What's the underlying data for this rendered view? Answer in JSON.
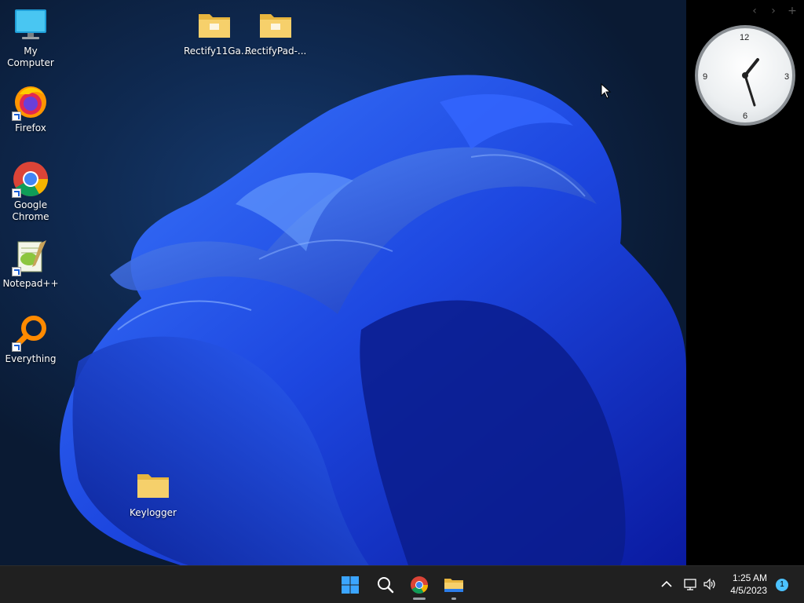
{
  "desktop": {
    "icons": [
      {
        "label": "My Computer",
        "icon": "monitor-icon"
      },
      {
        "label": "Firefox",
        "icon": "firefox-icon"
      },
      {
        "label": "Google Chrome",
        "icon": "chrome-icon"
      },
      {
        "label": "Notepad++",
        "icon": "notepad-plus-plus-icon"
      },
      {
        "label": "Everything",
        "icon": "everything-search-icon"
      },
      {
        "label": "Rectify11Ga...",
        "icon": "folder-icon"
      },
      {
        "label": "RectifyPad-...",
        "icon": "folder-icon"
      },
      {
        "label": "Keylogger",
        "icon": "folder-icon"
      }
    ]
  },
  "sidebar": {
    "nav": {
      "prev": "‹",
      "next": "›",
      "add": "+"
    },
    "clock": {
      "n12": "12",
      "n3": "3",
      "n6": "6",
      "n9": "9"
    }
  },
  "taskbar": {
    "pinned": [
      {
        "name": "start",
        "icon": "windows-start-icon"
      },
      {
        "name": "search",
        "icon": "search-icon"
      },
      {
        "name": "chrome",
        "icon": "chrome-icon"
      },
      {
        "name": "file-explorer",
        "icon": "file-explorer-icon"
      }
    ],
    "tray": {
      "time": "1:25 AM",
      "date": "4/5/2023",
      "notifications": "1"
    }
  },
  "colors": {
    "accent": "#4cc2ff",
    "taskbar": "#202020",
    "folder": "#f4c94c",
    "bloom": "#1f4fe0"
  }
}
